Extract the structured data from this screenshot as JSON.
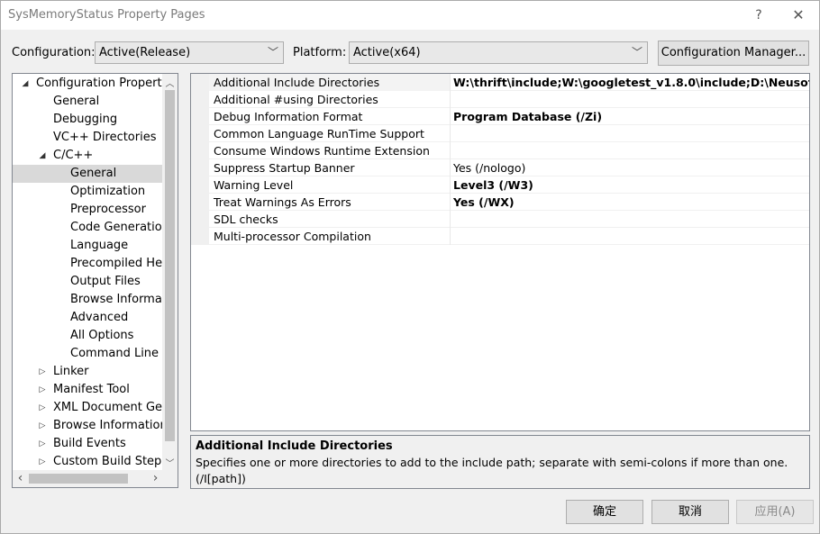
{
  "window": {
    "title": "SysMemoryStatus Property Pages",
    "help_glyph": "?",
    "close_glyph": "✕"
  },
  "toolbar": {
    "configuration_label": "Configuration:",
    "configuration_value": "Active(Release)",
    "platform_label": "Platform:",
    "platform_value": "Active(x64)",
    "config_manager_label": "Configuration Manager..."
  },
  "tree": {
    "items": [
      {
        "label": "Configuration Properties",
        "level": 0,
        "expander": "◢",
        "selected": false
      },
      {
        "label": "General",
        "level": 1,
        "expander": "",
        "selected": false
      },
      {
        "label": "Debugging",
        "level": 1,
        "expander": "",
        "selected": false
      },
      {
        "label": "VC++ Directories",
        "level": 1,
        "expander": "",
        "selected": false
      },
      {
        "label": "C/C++",
        "level": 1,
        "expander": "◢",
        "selected": false
      },
      {
        "label": "General",
        "level": 2,
        "expander": "",
        "selected": true
      },
      {
        "label": "Optimization",
        "level": 2,
        "expander": "",
        "selected": false
      },
      {
        "label": "Preprocessor",
        "level": 2,
        "expander": "",
        "selected": false
      },
      {
        "label": "Code Generation",
        "level": 2,
        "expander": "",
        "selected": false
      },
      {
        "label": "Language",
        "level": 2,
        "expander": "",
        "selected": false
      },
      {
        "label": "Precompiled Headers",
        "level": 2,
        "expander": "",
        "selected": false
      },
      {
        "label": "Output Files",
        "level": 2,
        "expander": "",
        "selected": false
      },
      {
        "label": "Browse Information",
        "level": 2,
        "expander": "",
        "selected": false
      },
      {
        "label": "Advanced",
        "level": 2,
        "expander": "",
        "selected": false
      },
      {
        "label": "All Options",
        "level": 2,
        "expander": "",
        "selected": false
      },
      {
        "label": "Command Line",
        "level": 2,
        "expander": "",
        "selected": false
      },
      {
        "label": "Linker",
        "level": 1,
        "expander": "▷",
        "selected": false
      },
      {
        "label": "Manifest Tool",
        "level": 1,
        "expander": "▷",
        "selected": false
      },
      {
        "label": "XML Document Generator",
        "level": 1,
        "expander": "▷",
        "selected": false
      },
      {
        "label": "Browse Information",
        "level": 1,
        "expander": "▷",
        "selected": false
      },
      {
        "label": "Build Events",
        "level": 1,
        "expander": "▷",
        "selected": false
      },
      {
        "label": "Custom Build Step",
        "level": 1,
        "expander": "▷",
        "selected": false
      }
    ],
    "scroll_up": "︿",
    "scroll_down": "﹀",
    "scroll_left": "‹",
    "scroll_right": "›"
  },
  "properties": [
    {
      "name": "Additional Include Directories",
      "value": "W:\\thrift\\include;W:\\googletest_v1.8.0\\include;D:\\Neusoft\\TechWiki",
      "bold": true,
      "selected": true
    },
    {
      "name": "Additional #using Directories",
      "value": "",
      "bold": false,
      "selected": false
    },
    {
      "name": "Debug Information Format",
      "value": "Program Database (/Zi)",
      "bold": true,
      "selected": false
    },
    {
      "name": "Common Language RunTime Support",
      "value": "",
      "bold": false,
      "selected": false
    },
    {
      "name": "Consume Windows Runtime Extension",
      "value": "",
      "bold": false,
      "selected": false
    },
    {
      "name": "Suppress Startup Banner",
      "value": "Yes (/nologo)",
      "bold": false,
      "selected": false
    },
    {
      "name": "Warning Level",
      "value": "Level3 (/W3)",
      "bold": true,
      "selected": false
    },
    {
      "name": "Treat Warnings As Errors",
      "value": "Yes (/WX)",
      "bold": true,
      "selected": false
    },
    {
      "name": "SDL checks",
      "value": "",
      "bold": false,
      "selected": false
    },
    {
      "name": "Multi-processor Compilation",
      "value": "",
      "bold": false,
      "selected": false
    }
  ],
  "description": {
    "title": "Additional Include Directories",
    "text": "Specifies one or more directories to add to the include path; separate with semi-colons if more than one.",
    "switch": "(/I[path])"
  },
  "buttons": {
    "ok": "确定",
    "cancel": "取消",
    "apply": "应用(A)"
  }
}
